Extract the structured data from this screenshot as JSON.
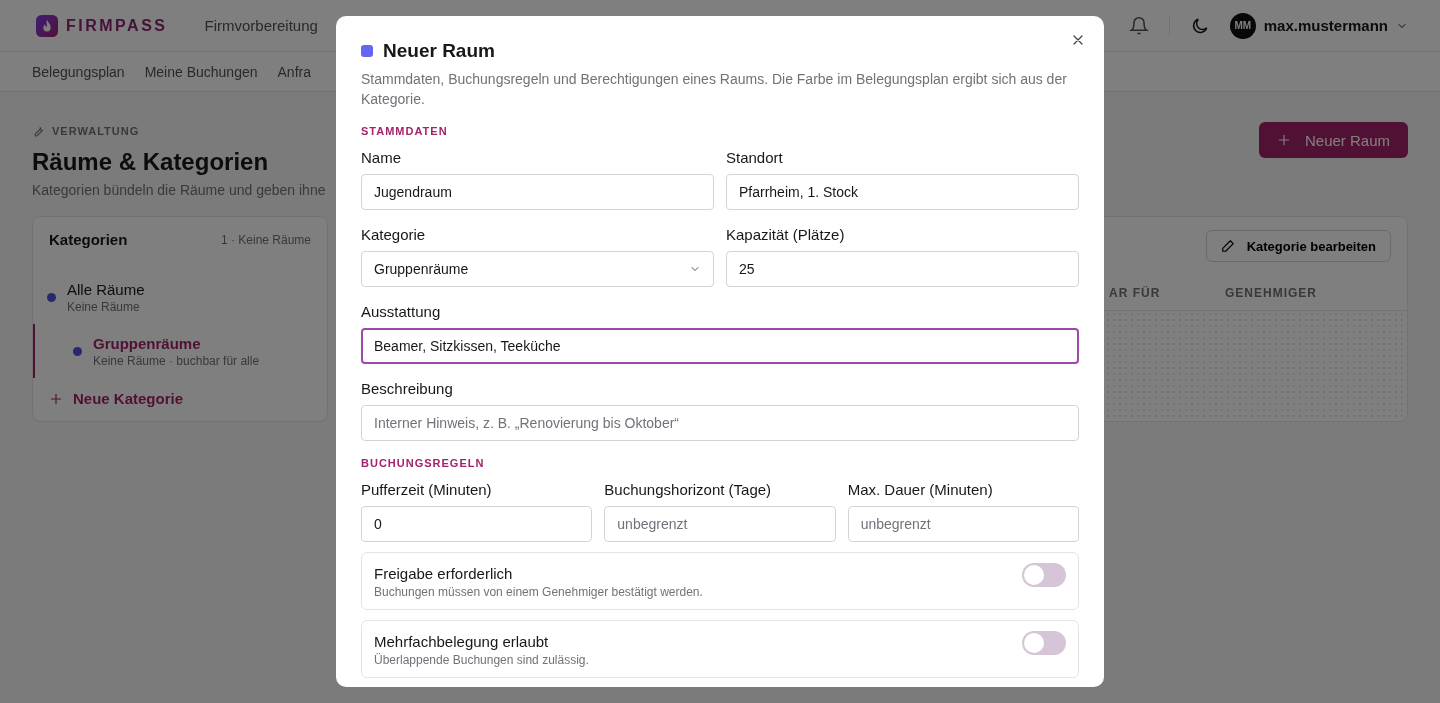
{
  "header": {
    "brand": "FIRMPASS",
    "nav": [
      {
        "label": "Firmvorbereitung",
        "selected": false
      }
    ],
    "user": {
      "initials": "MM",
      "name": "max.mustermann"
    }
  },
  "subnav": [
    {
      "label": "Belegungsplan",
      "selected": false
    },
    {
      "label": "Meine Buchungen",
      "selected": false
    },
    {
      "label": "Anfra",
      "selected": false
    }
  ],
  "page": {
    "eyebrow": "VERWALTUNG",
    "title": "Räume & Kategorien",
    "subtitle": "Kategorien bündeln die Räume und geben ihne",
    "primary_button": "Neuer Raum"
  },
  "categories": {
    "title": "Kategorien",
    "count": "1 · Keine Räume",
    "items": [
      {
        "name": "Alle Räume",
        "meta": "Keine Räume",
        "selected": false,
        "children": [
          {
            "name": "Gruppenräume",
            "meta": "Keine Räume · buchbar für alle",
            "selected": true
          }
        ]
      }
    ],
    "add_button": "Neue Kategorie"
  },
  "rooms": {
    "edit_button": "Kategorie bearbeiten",
    "columns": [
      "AR FÜR",
      "GENEHMIGER"
    ]
  },
  "modal": {
    "title": "Neuer Raum",
    "color": "#6366f1",
    "description": "Stammdaten, Buchungsregeln und Berechtigungen eines Raums. Die Farbe im Belegungsplan ergibt sich aus der Kategorie.",
    "sections": [
      {
        "heading": "STAMMDATEN",
        "fields": [
          {
            "label": "Name",
            "kind": "text",
            "value": "Jugendraum",
            "wide": false,
            "focused": false
          },
          {
            "label": "Standort",
            "kind": "text",
            "value": "Pfarrheim, 1. Stock",
            "wide": false,
            "focused": false
          },
          {
            "label": "Kategorie",
            "kind": "select",
            "value": "Gruppenräume",
            "wide": false,
            "focused": false
          },
          {
            "label": "Kapazität (Plätze)",
            "kind": "text",
            "value": "25",
            "wide": false,
            "focused": false
          },
          {
            "label": "Ausstattung",
            "kind": "text",
            "value": "Beamer, Sitzkissen, Teeküche",
            "wide": true,
            "focused": true
          },
          {
            "label": "Beschreibung",
            "kind": "text",
            "placeholder": "Interner Hinweis, z. B. „Renovierung bis Oktober“",
            "wide": true,
            "focused": false
          }
        ]
      },
      {
        "heading": "BUCHUNGSREGELN",
        "fields": [
          {
            "label": "Pufferzeit (Minuten)",
            "kind": "text",
            "value": "0",
            "wide": false,
            "focused": false
          },
          {
            "label": "Buchungshorizont (Tage)",
            "kind": "text",
            "placeholder": "unbegrenzt",
            "wide": false,
            "focused": false
          },
          {
            "label": "Max. Dauer (Minuten)",
            "kind": "text",
            "placeholder": "unbegrenzt",
            "wide": false,
            "focused": false
          }
        ]
      }
    ],
    "toggles": [
      {
        "title": "Freigabe erforderlich",
        "description": "Buchungen müssen von einem Genehmiger bestätigt werden.",
        "on": false
      },
      {
        "title": "Mehrfachbelegung erlaubt",
        "description": "Überlappende Buchungen sind zulässig.",
        "on": false
      }
    ]
  }
}
